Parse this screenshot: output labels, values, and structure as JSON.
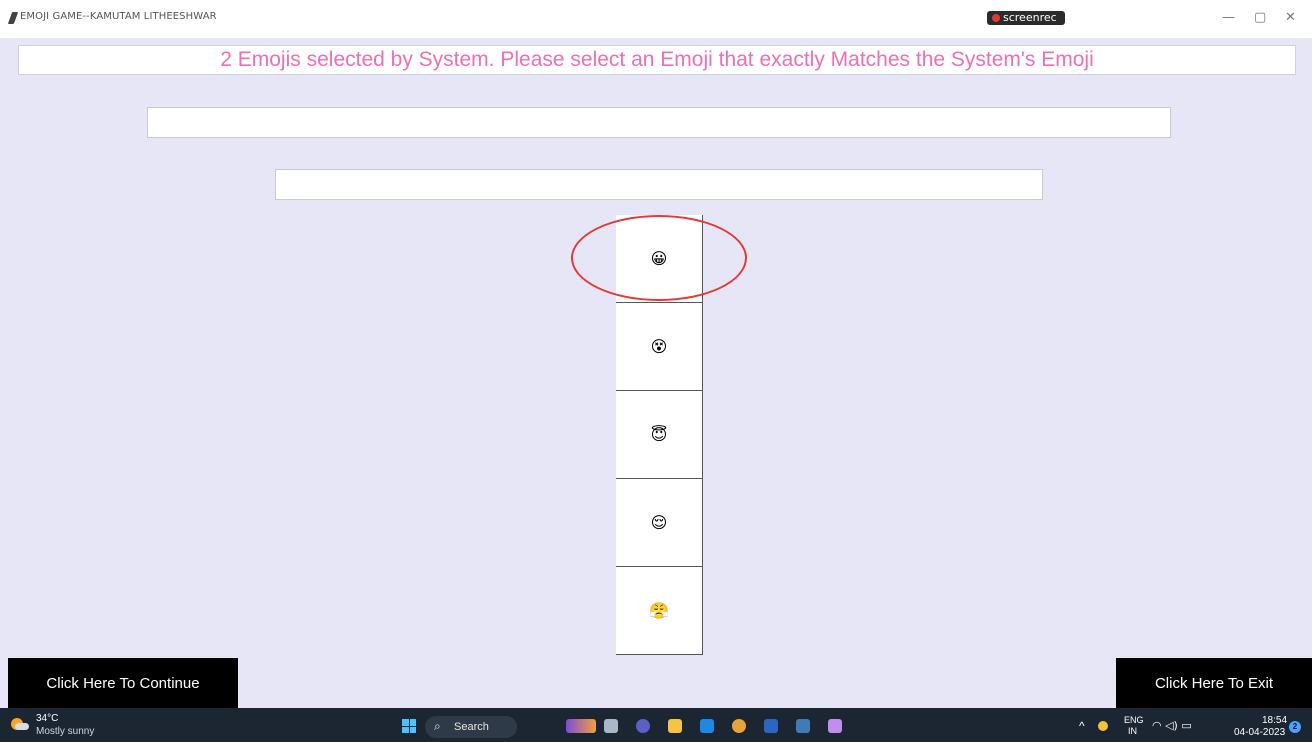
{
  "window": {
    "title": "EMOJI GAME--KAMUTAM LITHEESHWAR",
    "recorder_label": "screenrec",
    "controls": {
      "minimize": "—",
      "restore": "▢",
      "close": "✕"
    }
  },
  "instruction": "2 Emojis selected by System. Please select an Emoji that exactly Matches the System's Emoji",
  "fields": {
    "field1_value": "",
    "field2_value": ""
  },
  "emoji_options": [
    {
      "glyph": "😀",
      "highlighted": true
    },
    {
      "glyph": "😵",
      "highlighted": false
    },
    {
      "glyph": "😇",
      "highlighted": false
    },
    {
      "glyph": "😌",
      "highlighted": false
    },
    {
      "glyph": "😤",
      "highlighted": false
    }
  ],
  "buttons": {
    "continue_label": "Click Here To Continue",
    "exit_label": "Click Here To Exit"
  },
  "taskbar": {
    "weather_temp": "34°C",
    "weather_desc": "Mostly sunny",
    "search_label": "Search",
    "lang_line1": "ENG",
    "lang_line2": "IN",
    "time": "18:54",
    "date": "04-04-2023",
    "notifications": "2"
  },
  "colors": {
    "app_background": "#e6e6f7",
    "instruction_text": "#ef6fb3",
    "highlight_circle": "#e53935",
    "action_button_bg": "#000000"
  }
}
